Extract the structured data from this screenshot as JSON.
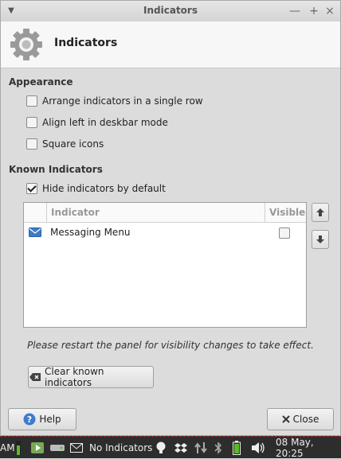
{
  "window": {
    "title": "Indicators",
    "menu_icon": "chevron-down-icon",
    "controls": [
      "minimize",
      "maximize",
      "close"
    ],
    "minimize_glyph": "—",
    "maximize_glyph": "+",
    "close_glyph": "×"
  },
  "header": {
    "icon": "gear-icon",
    "title": "Indicators"
  },
  "appearance": {
    "title": "Appearance",
    "options": [
      {
        "label": "Arrange indicators in a single row",
        "checked": false
      },
      {
        "label": "Align left in deskbar mode",
        "checked": false
      },
      {
        "label": "Square icons",
        "checked": false
      }
    ]
  },
  "known": {
    "title": "Known Indicators",
    "hide_default": {
      "label": "Hide indicators by default",
      "checked": true
    },
    "columns": {
      "indicator": "Indicator",
      "visible": "Visible"
    },
    "rows": [
      {
        "icon": "envelope-icon",
        "label": "Messaging Menu",
        "visible": false
      }
    ],
    "move_up_icon": "arrow-up-icon",
    "move_down_icon": "arrow-down-icon",
    "note": "Please restart the panel for visibility changes to take effect.",
    "clear_button": "Clear known indicators"
  },
  "footer": {
    "help_button": "Help",
    "close_button": "Close"
  },
  "taskbar": {
    "left_text": "AM",
    "indicator_text": "No Indicators",
    "clock": "08 May, 20:25"
  },
  "colors": {
    "accent_blue": "#3d7cc9",
    "battery_green": "#5cb82e"
  }
}
